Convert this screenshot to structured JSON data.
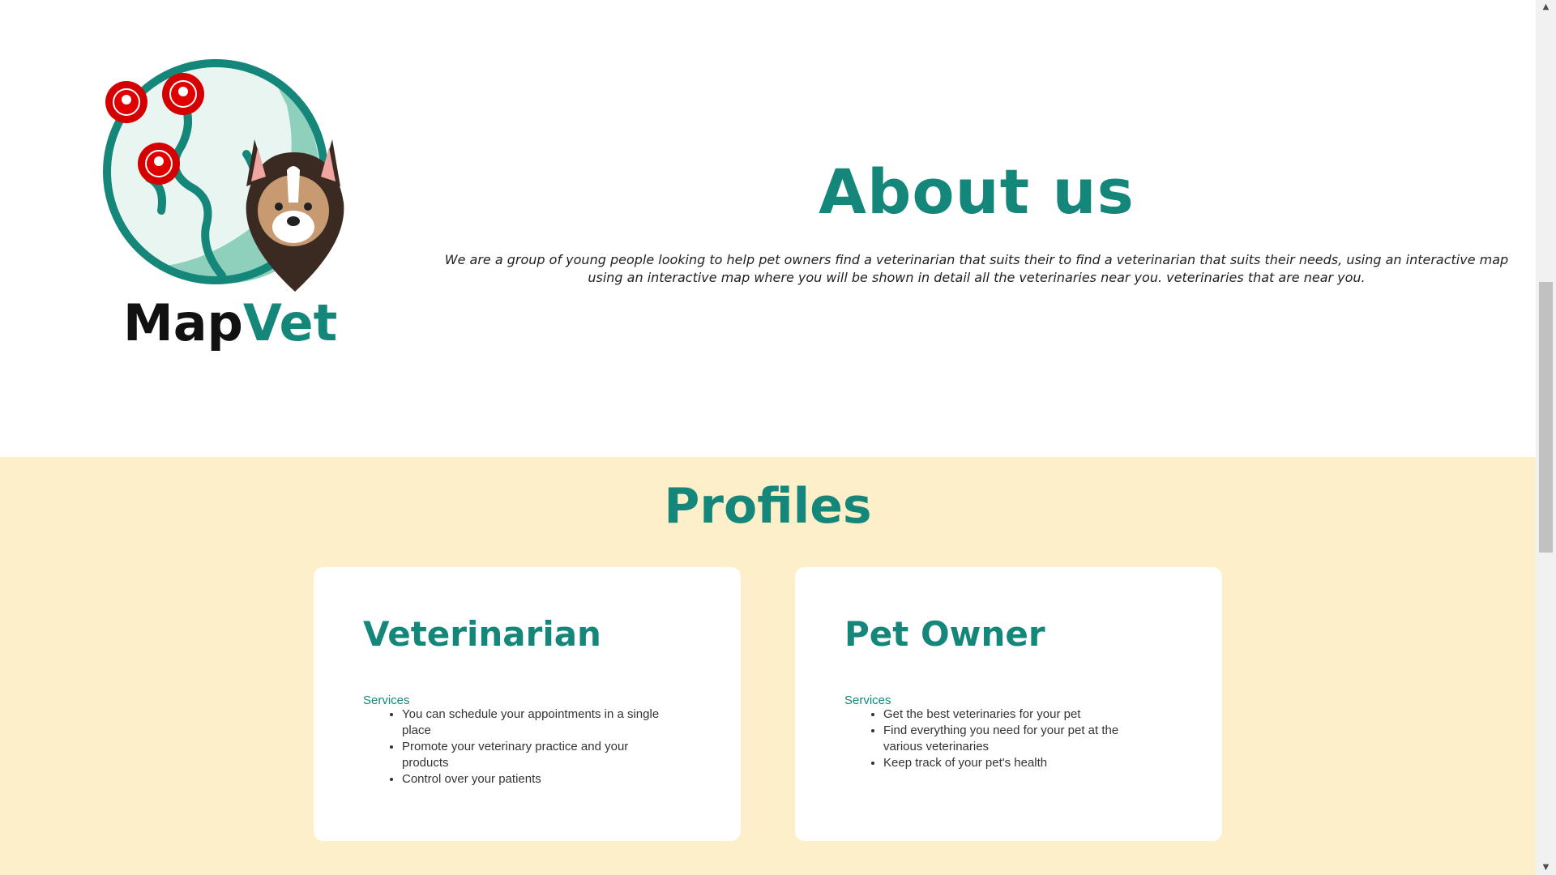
{
  "about": {
    "logo_text_map": "Map",
    "logo_text_vet": "Vet",
    "title": "About us",
    "description": "We are a group of young people looking to help pet owners find a veterinarian that suits their to find a veterinarian that suits their needs, using an interactive map using an interactive map where you will be shown in detail all the veterinaries near you. veterinaries that are near you."
  },
  "profiles": {
    "title": "Profiles",
    "cards": [
      {
        "title": "Veterinarian",
        "services_label": "Services",
        "items": [
          "You can schedule your appointments in a single place",
          "Promote your veterinary practice and your products",
          "Control over your patients"
        ]
      },
      {
        "title": "Pet Owner",
        "services_label": "Services",
        "items": [
          "Get the best veterinaries for your pet",
          "Find everything you need for your pet at the various veterinaries",
          "Keep track of your pet's health"
        ]
      }
    ]
  },
  "colors": {
    "accent": "#14877a",
    "profiles_bg": "#fdefc9",
    "pin_red": "#d40000"
  },
  "icons": {
    "scroll_up": "▲",
    "scroll_down": "▼"
  }
}
